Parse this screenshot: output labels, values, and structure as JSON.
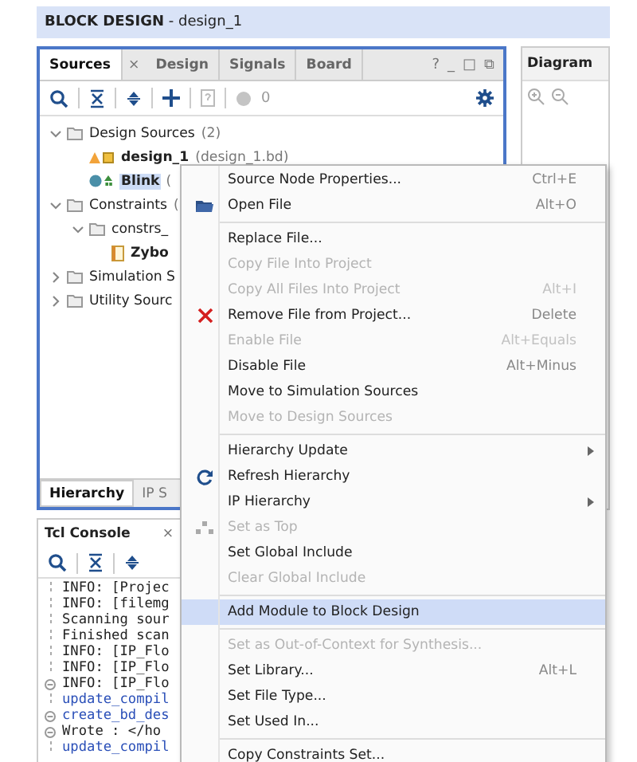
{
  "title": "**BLOCK DESIGN** - design_1",
  "sources_panel": {
    "tabs": [
      {
        "label": "Sources",
        "selected": true
      },
      {
        "label": "Design",
        "selected": false
      },
      {
        "label": "Signals",
        "selected": false
      },
      {
        "label": "Board",
        "selected": false
      }
    ],
    "close": "×",
    "window_buttons": [
      "?",
      "_",
      "□",
      "⧉"
    ],
    "counter": "0",
    "tree": [
      {
        "kind": "folder",
        "label": "Design Sources",
        "detail": "(2)",
        "expanded": true,
        "selected": false,
        "children": [
          {
            "kind": "block_design",
            "label": "design_1",
            "detail": "(design_1.bd)",
            "selected": false
          },
          {
            "kind": "module",
            "label": "Blink",
            "detail": "(",
            "selected": true
          }
        ]
      },
      {
        "kind": "folder",
        "label": "Constraints",
        "detail": "(",
        "expanded": true,
        "selected": false,
        "children": [
          {
            "kind": "folder",
            "label": "constrs_",
            "expanded": true,
            "selected": false,
            "children": [
              {
                "kind": "file",
                "label": "Zybo",
                "selected": false
              }
            ]
          }
        ]
      },
      {
        "kind": "folder",
        "label": "Simulation S",
        "expanded": false,
        "selected": false
      },
      {
        "kind": "folder",
        "label": "Utility Sourc",
        "expanded": false,
        "selected": false
      }
    ],
    "bottom_tabs": [
      {
        "label": "Hierarchy",
        "selected": true
      },
      {
        "label": "IP S",
        "selected": false
      }
    ]
  },
  "diagram_panel": {
    "title": "Diagram"
  },
  "tcl_console": {
    "title": "Tcl Console",
    "close": "×",
    "lines": [
      {
        "text": "INFO: [Projec",
        "kind": "info",
        "fold": false
      },
      {
        "text": "INFO: [filemg",
        "kind": "info",
        "fold": false
      },
      {
        "text": "Scanning sour",
        "kind": "info",
        "fold": false
      },
      {
        "text": "Finished scan",
        "kind": "info",
        "fold": false
      },
      {
        "text": "INFO: [IP_Flo",
        "kind": "info",
        "fold": false
      },
      {
        "text": "INFO: [IP_Flo",
        "kind": "info",
        "fold": false
      },
      {
        "text": "INFO: [IP_Flo",
        "kind": "info",
        "fold": true
      },
      {
        "text": "update_compil",
        "kind": "command",
        "fold": false
      },
      {
        "text": "create_bd_des",
        "kind": "command",
        "fold": true
      },
      {
        "text": "Wrote  : </ho",
        "kind": "info",
        "fold": true
      },
      {
        "text": "update_compil",
        "kind": "command",
        "fold": false
      }
    ]
  },
  "context_menu": {
    "items": [
      {
        "kind": "item",
        "label": "Source Node Properties...",
        "shortcut": "Ctrl+E",
        "disabled": false,
        "selected": false
      },
      {
        "kind": "item",
        "label": "Open File",
        "shortcut": "Alt+O",
        "disabled": false,
        "selected": false
      },
      {
        "kind": "separator"
      },
      {
        "kind": "item",
        "label": "Replace File...",
        "disabled": false,
        "selected": false
      },
      {
        "kind": "item",
        "label": "Copy File Into Project",
        "disabled": true,
        "selected": false
      },
      {
        "kind": "item",
        "label": "Copy All Files Into Project",
        "shortcut": "Alt+I",
        "disabled": true,
        "selected": false
      },
      {
        "kind": "item",
        "label": "Remove File from Project...",
        "shortcut": "Delete",
        "disabled": false,
        "selected": false
      },
      {
        "kind": "item",
        "label": "Enable File",
        "shortcut": "Alt+Equals",
        "disabled": true,
        "selected": false
      },
      {
        "kind": "item",
        "label": "Disable File",
        "shortcut": "Alt+Minus",
        "disabled": false,
        "selected": false
      },
      {
        "kind": "item",
        "label": "Move to Simulation Sources",
        "disabled": false,
        "selected": false
      },
      {
        "kind": "item",
        "label": "Move to Design Sources",
        "disabled": true,
        "selected": false
      },
      {
        "kind": "separator"
      },
      {
        "kind": "item",
        "label": "Hierarchy Update",
        "disabled": false,
        "selected": false,
        "submenu": true
      },
      {
        "kind": "item",
        "label": "Refresh Hierarchy",
        "disabled": false,
        "selected": false
      },
      {
        "kind": "item",
        "label": "IP Hierarchy",
        "disabled": false,
        "selected": false,
        "submenu": true
      },
      {
        "kind": "item",
        "label": "Set as Top",
        "disabled": true,
        "selected": false
      },
      {
        "kind": "item",
        "label": "Set Global Include",
        "disabled": false,
        "selected": false
      },
      {
        "kind": "item",
        "label": "Clear Global Include",
        "disabled": true,
        "selected": false
      },
      {
        "kind": "separator"
      },
      {
        "kind": "item",
        "label": "Add Module to Block Design",
        "disabled": false,
        "selected": true
      },
      {
        "kind": "separator"
      },
      {
        "kind": "item",
        "label": "Set as Out-of-Context for Synthesis...",
        "disabled": true,
        "selected": false
      },
      {
        "kind": "item",
        "label": "Set Library...",
        "shortcut": "Alt+L",
        "disabled": false,
        "selected": false
      },
      {
        "kind": "item",
        "label": "Set File Type...",
        "disabled": false,
        "selected": false
      },
      {
        "kind": "item",
        "label": "Set Used In...",
        "disabled": false,
        "selected": false
      },
      {
        "kind": "separator"
      },
      {
        "kind": "item",
        "label": "Copy Constraints Set...",
        "disabled": false,
        "selected": false
      }
    ]
  }
}
